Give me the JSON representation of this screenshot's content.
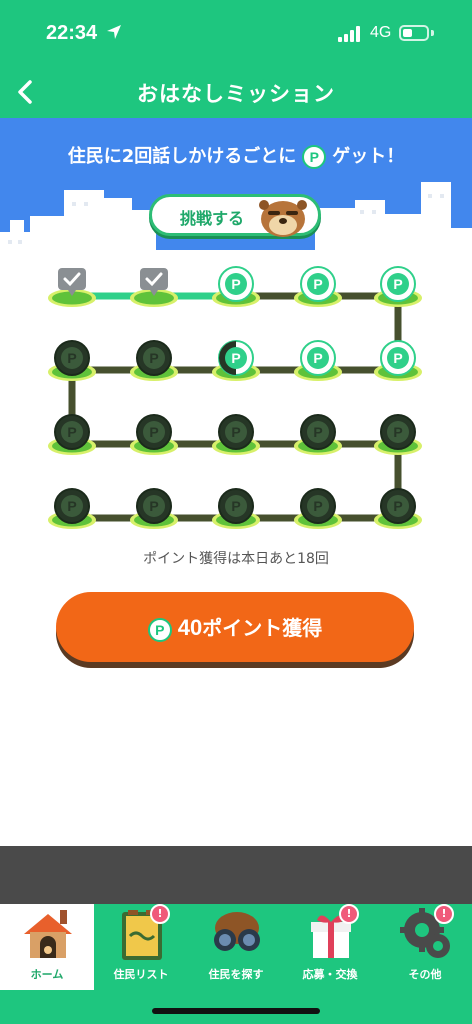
{
  "status_bar": {
    "time": "22:34",
    "network": "4G"
  },
  "nav": {
    "title": "おはなしミッション"
  },
  "banner": {
    "prefix": "住民に2回話しかけるごとに",
    "coin": "P",
    "suffix": "ゲット！"
  },
  "challenge": {
    "label": "挑戦する"
  },
  "mission": {
    "coin_label": "P",
    "rows": [
      [
        "done",
        "done",
        "available",
        "available",
        "available"
      ],
      [
        "locked",
        "locked",
        "half",
        "available",
        "available"
      ],
      [
        "locked",
        "locked",
        "locked",
        "locked",
        "locked"
      ],
      [
        "locked",
        "locked",
        "locked",
        "locked",
        "locked"
      ]
    ]
  },
  "points_left": "ポイント獲得は本日あと18回",
  "get_button": {
    "coin": "P",
    "number": "40",
    "label": "ポイント獲得"
  },
  "tabs": [
    {
      "label": "ホーム",
      "icon": "house-icon",
      "badge": ""
    },
    {
      "label": "住民リスト",
      "icon": "resident-list-icon",
      "badge": "!"
    },
    {
      "label": "住民を探す",
      "icon": "binoculars-icon",
      "badge": ""
    },
    {
      "label": "応募・交換",
      "icon": "gift-icon",
      "badge": "!"
    },
    {
      "label": "その他",
      "icon": "gear-icon",
      "badge": "!"
    }
  ],
  "colors": {
    "primary": "#1ec67f",
    "sky": "#4287ed",
    "orange": "#f26717",
    "badge": "#f05a7a"
  }
}
